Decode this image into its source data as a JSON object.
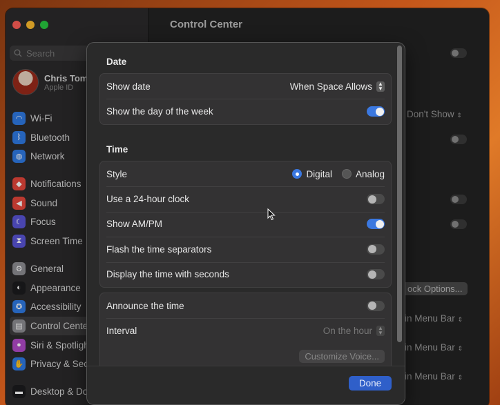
{
  "window": {
    "title": "Control Center"
  },
  "search": {
    "placeholder": "Search"
  },
  "account": {
    "name": "Chris Tom",
    "sub": "Apple ID"
  },
  "sidebar": {
    "group1": [
      {
        "label": "Wi-Fi",
        "icon": "wifi-icon",
        "color": "#2f7ae5"
      },
      {
        "label": "Bluetooth",
        "icon": "bluetooth-icon",
        "color": "#2f7ae5"
      },
      {
        "label": "Network",
        "icon": "globe-icon",
        "color": "#2f7ae5"
      }
    ],
    "group2": [
      {
        "label": "Notifications",
        "icon": "bell-icon",
        "color": "#e5463b"
      },
      {
        "label": "Sound",
        "icon": "speaker-icon",
        "color": "#e5463b"
      },
      {
        "label": "Focus",
        "icon": "moon-icon",
        "color": "#5a55d6"
      },
      {
        "label": "Screen Time",
        "icon": "hourglass-icon",
        "color": "#5a55d6"
      }
    ],
    "group3": [
      {
        "label": "General",
        "icon": "gear-icon",
        "color": "#8e8e93"
      },
      {
        "label": "Appearance",
        "icon": "appearance-icon",
        "color": "#1c1c1e"
      },
      {
        "label": "Accessibility",
        "icon": "accessibility-icon",
        "color": "#2f7ae5"
      },
      {
        "label": "Control Cente",
        "icon": "control-center-icon",
        "color": "#8e8e93"
      },
      {
        "label": "Siri & Spotligh",
        "icon": "siri-icon",
        "color": "#b14ac9"
      },
      {
        "label": "Privacy & Sec",
        "icon": "hand-icon",
        "color": "#2f7ae5"
      }
    ],
    "group4": [
      {
        "label": "Desktop & Do",
        "icon": "dock-icon",
        "color": "#1c1c1e"
      }
    ]
  },
  "background": {
    "dont_show": "Don't Show",
    "clock_options": "ock Options...",
    "menu_bar_1": "in Menu Bar",
    "menu_bar_2": "in Menu Bar",
    "menu_bar_3": "in Menu Bar"
  },
  "sheet": {
    "date": {
      "title": "Date",
      "show_date_label": "Show date",
      "show_date_value": "When Space Allows",
      "show_day_label": "Show the day of the week",
      "show_day_on": true
    },
    "time": {
      "title": "Time",
      "style_label": "Style",
      "style_digital": "Digital",
      "style_analog": "Analog",
      "style_selected": "Digital",
      "clock24_label": "Use a 24-hour clock",
      "clock24_on": false,
      "ampm_label": "Show AM/PM",
      "ampm_on": true,
      "flash_label": "Flash the time separators",
      "flash_on": false,
      "seconds_label": "Display the time with seconds",
      "seconds_on": false
    },
    "announce": {
      "label": "Announce the time",
      "on": false,
      "interval_label": "Interval",
      "interval_value": "On the hour",
      "customize_label": "Customize Voice..."
    },
    "done_label": "Done"
  },
  "colors": {
    "accent": "#3b78e0",
    "done_button": "#2f5fc9"
  }
}
